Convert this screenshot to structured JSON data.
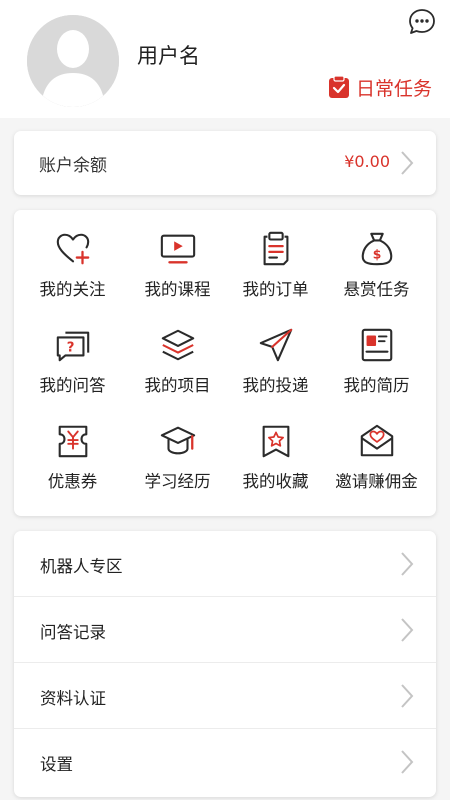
{
  "profile": {
    "username": "用户名",
    "daily_task_label": "日常任务"
  },
  "balance": {
    "label": "账户余额",
    "value": "¥0.00"
  },
  "grid": [
    {
      "label": "我的关注",
      "icon": "heart-plus-icon"
    },
    {
      "label": "我的课程",
      "icon": "video-play-icon"
    },
    {
      "label": "我的订单",
      "icon": "clipboard-icon"
    },
    {
      "label": "悬赏任务",
      "icon": "money-bag-icon"
    },
    {
      "label": "我的问答",
      "icon": "question-chat-icon"
    },
    {
      "label": "我的项目",
      "icon": "layers-icon"
    },
    {
      "label": "我的投递",
      "icon": "paper-plane-icon"
    },
    {
      "label": "我的简历",
      "icon": "resume-icon"
    },
    {
      "label": "优惠券",
      "icon": "coupon-icon"
    },
    {
      "label": "学习经历",
      "icon": "graduation-cap-icon"
    },
    {
      "label": "我的收藏",
      "icon": "bookmark-star-icon"
    },
    {
      "label": "邀请赚佣金",
      "icon": "envelope-heart-icon"
    }
  ],
  "menu": [
    {
      "label": "机器人专区"
    },
    {
      "label": "问答记录"
    },
    {
      "label": "资料认证"
    },
    {
      "label": "设置"
    }
  ],
  "colors": {
    "accent": "#d9332b",
    "icon_dark": "#2b2b2b",
    "background": "#f5f5f5",
    "card": "#ffffff"
  }
}
